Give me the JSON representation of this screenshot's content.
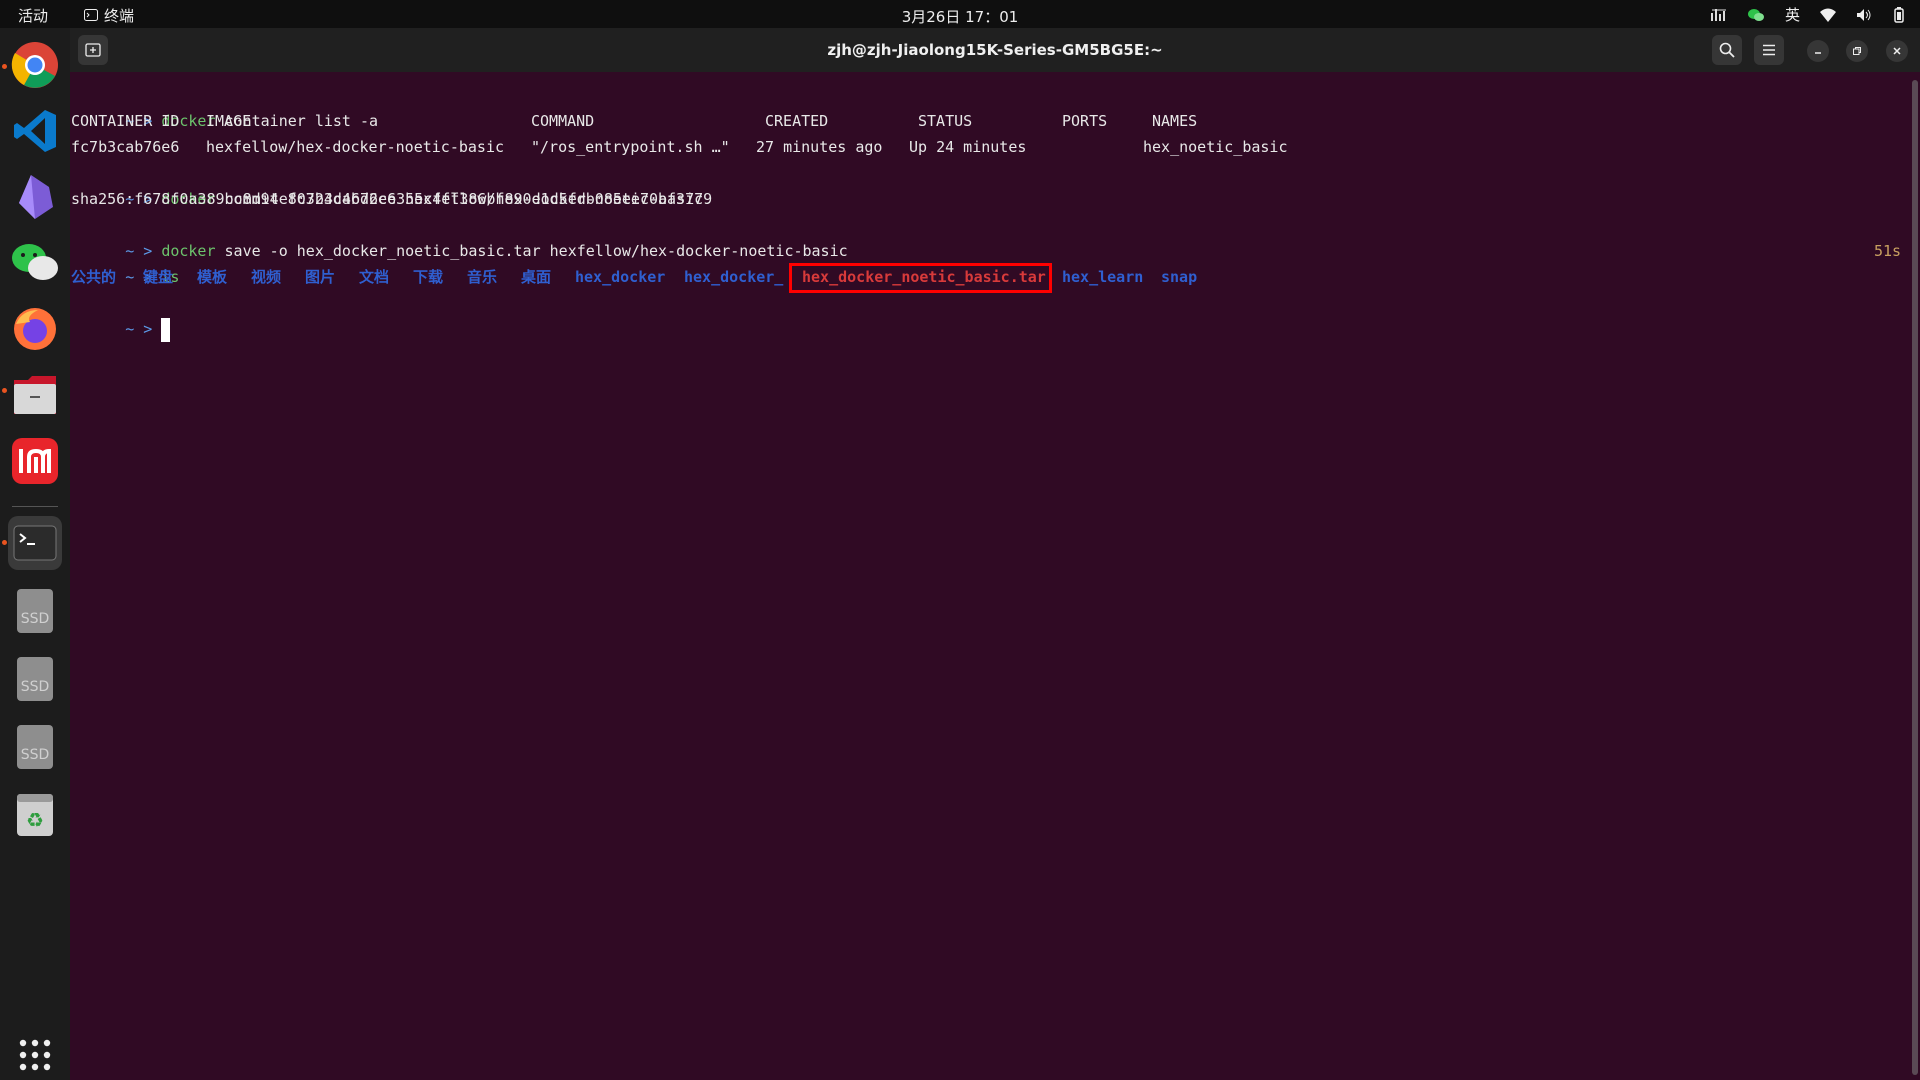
{
  "topbar": {
    "activities": "活动",
    "app_name": "终端",
    "clock": "3月26日  17：01",
    "input_method": "英"
  },
  "dock": {
    "items": [
      "chrome-icon",
      "vscode-icon",
      "obsidian-icon",
      "wechat-icon",
      "firefox-icon",
      "files-icon",
      "redmi-icon",
      "terminal-icon",
      "ssd-drive-icon",
      "ssd-drive-icon",
      "ssd-drive-icon",
      "trash-icon",
      "app-grid-icon"
    ],
    "ssd_label": "SSD"
  },
  "window": {
    "title": "zjh@zjh-Jiaolong15K-Series-GM5BG5E:~"
  },
  "terminal": {
    "prompt": "~ >",
    "cmd1_word": "docker",
    "cmd1_rest": " container list -a",
    "table_headers": [
      "CONTAINER ID",
      "IMAGE",
      "COMMAND",
      "CREATED",
      "STATUS",
      "PORTS",
      "NAMES"
    ],
    "table_row": [
      "fc7b3cab76e6",
      "hexfellow/hex-docker-noetic-basic",
      "\"/ros_entrypoint.sh …\"",
      "27 minutes ago",
      "Up 24 minutes",
      "",
      "hex_noetic_basic"
    ],
    "cmd2_word": "docker",
    "cmd2_rest": " commit fc7b3cab76e6 hexfellow/hex-docker-noetic-basic",
    "sha": "sha256:f678f0a389bc8d94e80324d46d2ce355c4ff386bf890e1d5fdb085ee70af3779",
    "cmd3_word": "docker",
    "cmd3_rest": " save -o hex_docker_noetic_basic.tar hexfellow/hex-docker-noetic-basic",
    "cmd4": "ls",
    "duration": "51s",
    "ls_entries": [
      "公共的",
      "键盘",
      "模板",
      "视频",
      "图片",
      "文档",
      "下载",
      "音乐",
      "桌面",
      "hex_docker",
      "hex_docker_"
    ],
    "ls_highlight": "hex_docker_noetic_basic.tar",
    "ls_entries_after": [
      "hex_learn",
      "snap"
    ]
  },
  "colors": {
    "terminal_bg": "#300a24",
    "prompt": "#5c9ae8",
    "command": "#6cc36c",
    "directory": "#2f5fd0",
    "highlight": "#ff0000"
  }
}
